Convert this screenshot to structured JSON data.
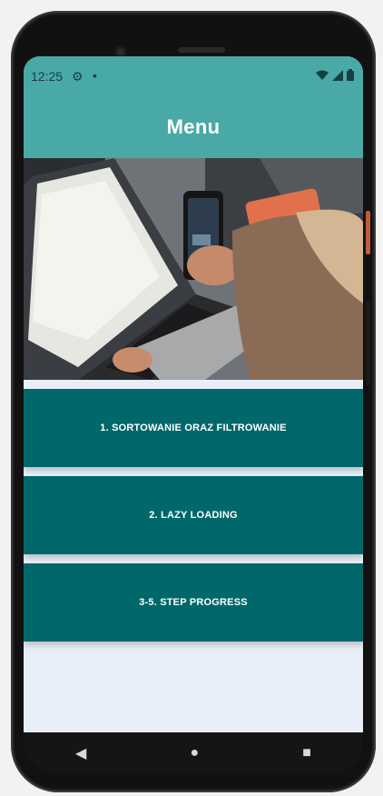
{
  "status": {
    "time": "12:25",
    "gear_icon": "gear-icon",
    "dot": "•",
    "wifi_icon": "wifi-icon",
    "signal_icon": "signal-icon",
    "battery_icon": "battery-icon"
  },
  "appbar": {
    "title": "Menu"
  },
  "menu": {
    "items": [
      {
        "label": "1.  SORTOWANIE ORAZ FILTROWANIE"
      },
      {
        "label": "2.  LAZY LOADING"
      },
      {
        "label": "3-5.  STEP PROGRESS"
      }
    ]
  },
  "colors": {
    "appbar": "#49a9a6",
    "menu_card": "#00676a",
    "background": "#e8eff8"
  },
  "nav": {
    "back_icon": "back-icon",
    "home_icon": "home-icon",
    "recents_icon": "recents-icon"
  }
}
